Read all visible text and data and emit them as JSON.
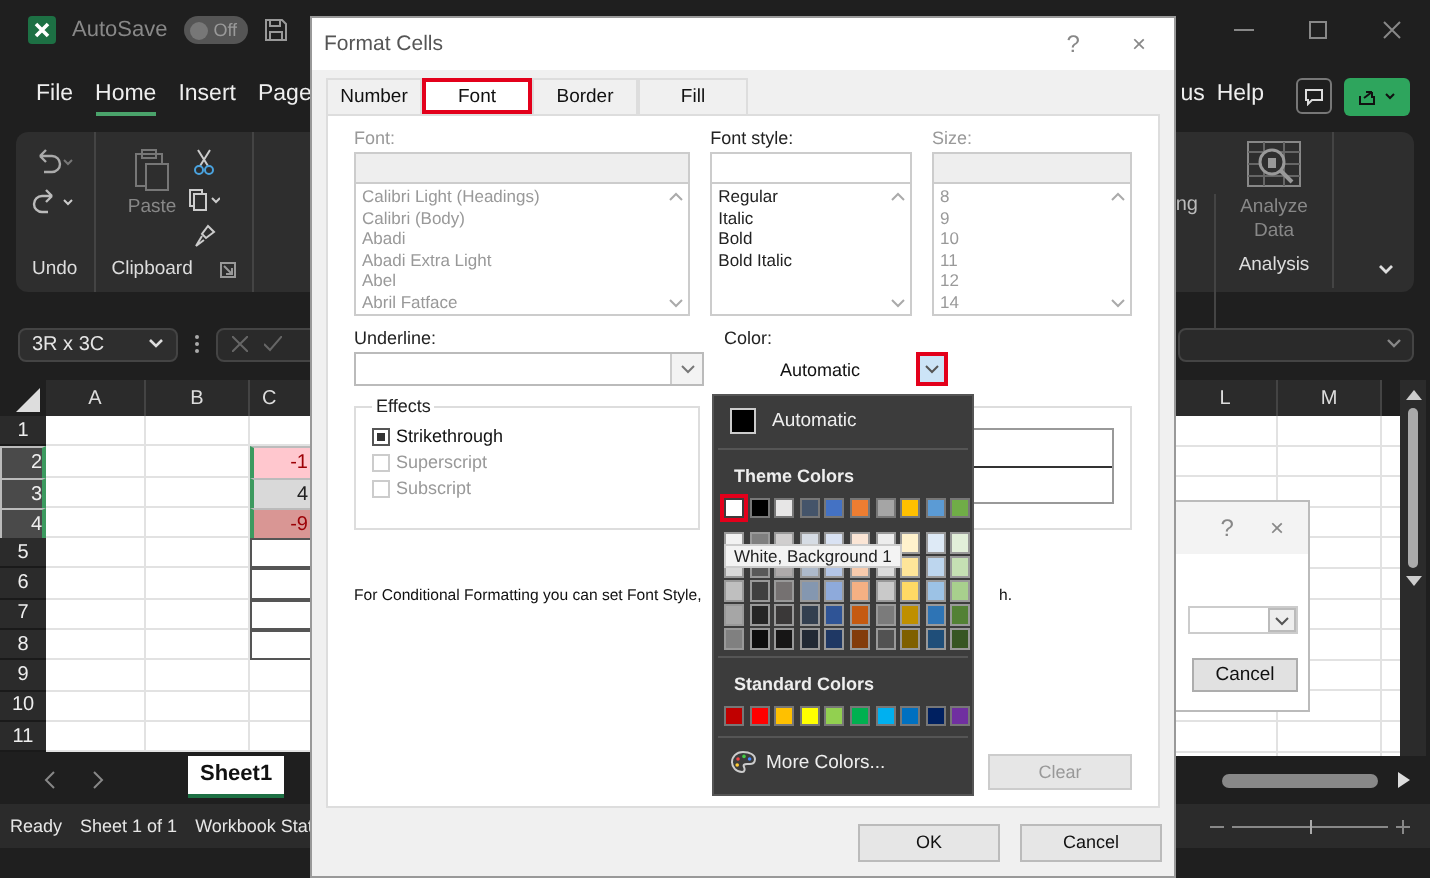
{
  "app": {
    "autosave_label": "AutoSave",
    "autosave_state": "Off",
    "autosave_on": false
  },
  "menu": [
    {
      "label": "File",
      "selected": false
    },
    {
      "label": "Home",
      "selected": true
    },
    {
      "label": "Insert",
      "selected": false
    },
    {
      "label": "Page",
      "selected": false
    }
  ],
  "menu_right": [
    "us",
    "Help"
  ],
  "ribbon": {
    "paste": "Paste",
    "undo_group": "Undo",
    "clipboard_group": "Clipboard",
    "partial_label": "ng",
    "analyze": "Analyze Data",
    "analysis_group": "Analysis"
  },
  "name_box": "3R x 3C",
  "grid": {
    "columns_left": [
      "A",
      "B",
      "C"
    ],
    "columns_right": [
      "L",
      "M"
    ],
    "rows": [
      {
        "num": "1",
        "selected": false,
        "bordered": false
      },
      {
        "num": "2",
        "selected": true,
        "bordered": false,
        "value": "-1",
        "color": "#ffc7ce",
        "kind": "negative"
      },
      {
        "num": "3",
        "selected": true,
        "bordered": false,
        "value": "4",
        "color": "#d9d9d9",
        "kind": "positive"
      },
      {
        "num": "4",
        "selected": true,
        "bordered": false,
        "value": "-9",
        "color": "#d99694",
        "kind": "negative"
      },
      {
        "num": "5",
        "selected": false,
        "bordered": true
      },
      {
        "num": "6",
        "selected": false,
        "bordered": true
      },
      {
        "num": "7",
        "selected": false,
        "bordered": true
      },
      {
        "num": "8",
        "selected": false,
        "bordered": true
      },
      {
        "num": "9",
        "selected": false,
        "bordered": false
      },
      {
        "num": "10",
        "selected": false,
        "bordered": false
      },
      {
        "num": "11",
        "selected": false,
        "bordered": false
      }
    ]
  },
  "sheet_tabs": [
    {
      "label": "Sheet1",
      "selected": true
    }
  ],
  "status_bar": [
    "Ready",
    "Sheet 1 of 1",
    "Workbook Stat"
  ],
  "zoom_slider": {
    "level": 0.5
  },
  "dialog": {
    "title": "Format Cells",
    "help": "?",
    "close": "×",
    "tabs": [
      {
        "label": "Number",
        "selected": false,
        "highlighted": false
      },
      {
        "label": "Font",
        "selected": true,
        "highlighted": true
      },
      {
        "label": "Border",
        "selected": false,
        "highlighted": false
      },
      {
        "label": "Fill",
        "selected": false,
        "highlighted": false
      }
    ],
    "font": {
      "label": "Font:",
      "items": [
        "Calibri Light (Headings)",
        "Calibri (Body)",
        "Abadi",
        "Abadi Extra Light",
        "Abel",
        "Abril Fatface"
      ]
    },
    "font_style": {
      "label": "Font style:",
      "items": [
        "Regular",
        "Italic",
        "Bold",
        "Bold Italic"
      ]
    },
    "size": {
      "label": "Size:",
      "items": [
        "8",
        "9",
        "10",
        "11",
        "12",
        "14"
      ]
    },
    "underline": {
      "label": "Underline:"
    },
    "color": {
      "label": "Color:",
      "value": "Automatic",
      "button_highlighted": true
    },
    "effects": {
      "title": "Effects",
      "items": [
        {
          "label": "Strikethrough",
          "checked": true,
          "disabled": false
        },
        {
          "label": "Superscript",
          "checked": false,
          "disabled": true
        },
        {
          "label": "Subscript",
          "checked": false,
          "disabled": true
        }
      ]
    },
    "note": "For Conditional Formatting you can set Font Style,",
    "note_tail": "h.",
    "clear": "Clear",
    "buttons": [
      "OK",
      "Cancel"
    ]
  },
  "color_menu": {
    "automatic": "Automatic",
    "theme_title": "Theme Colors",
    "theme": [
      {
        "color": "#ffffff",
        "highlighted": true,
        "shades": [
          {
            "color": "#f2f2f2"
          },
          {
            "color": "#d9d9d9"
          },
          {
            "color": "#bfbfbf"
          },
          {
            "color": "#a6a6a6"
          },
          {
            "color": "#808080"
          }
        ]
      },
      {
        "color": "#000000",
        "highlighted": false,
        "shades": [
          {
            "color": "#7f7f7f"
          },
          {
            "color": "#595959"
          },
          {
            "color": "#404040"
          },
          {
            "color": "#262626"
          },
          {
            "color": "#0d0d0d"
          }
        ]
      },
      {
        "color": "#e7e6e6",
        "highlighted": false,
        "shades": [
          {
            "color": "#d0cece"
          },
          {
            "color": "#aeaaaa"
          },
          {
            "color": "#757171"
          },
          {
            "color": "#3a3838"
          },
          {
            "color": "#171616"
          }
        ]
      },
      {
        "color": "#44546a",
        "highlighted": false,
        "shades": [
          {
            "color": "#d6dce4"
          },
          {
            "color": "#adb9ca"
          },
          {
            "color": "#8497b0"
          },
          {
            "color": "#333f4f"
          },
          {
            "color": "#222a35"
          }
        ]
      },
      {
        "color": "#4472c4",
        "highlighted": false,
        "shades": [
          {
            "color": "#d9e2f3"
          },
          {
            "color": "#b4c6e7"
          },
          {
            "color": "#8eaadb"
          },
          {
            "color": "#2f5496"
          },
          {
            "color": "#1f3864"
          }
        ]
      },
      {
        "color": "#ed7d31",
        "highlighted": false,
        "shades": [
          {
            "color": "#fbe5d5"
          },
          {
            "color": "#f7caac"
          },
          {
            "color": "#f4b083"
          },
          {
            "color": "#c55a11"
          },
          {
            "color": "#833c0b"
          }
        ]
      },
      {
        "color": "#a5a5a5",
        "highlighted": false,
        "shades": [
          {
            "color": "#ededed"
          },
          {
            "color": "#dbdbdb"
          },
          {
            "color": "#c9c9c9"
          },
          {
            "color": "#7b7b7b"
          },
          {
            "color": "#525252"
          }
        ]
      },
      {
        "color": "#ffc000",
        "highlighted": false,
        "shades": [
          {
            "color": "#fff2cc"
          },
          {
            "color": "#fee599"
          },
          {
            "color": "#ffd965"
          },
          {
            "color": "#bf8f00"
          },
          {
            "color": "#7f6000"
          }
        ]
      },
      {
        "color": "#5b9bd5",
        "highlighted": false,
        "shades": [
          {
            "color": "#deeaf6"
          },
          {
            "color": "#bdd6ee"
          },
          {
            "color": "#9cc2e5"
          },
          {
            "color": "#2e74b5"
          },
          {
            "color": "#1f4e79"
          }
        ]
      },
      {
        "color": "#70ad47",
        "highlighted": false,
        "shades": [
          {
            "color": "#e2efd9"
          },
          {
            "color": "#c5e0b3"
          },
          {
            "color": "#a8d08d"
          },
          {
            "color": "#538135"
          },
          {
            "color": "#375623"
          }
        ]
      }
    ],
    "tooltip": "White, Background 1",
    "standard_title": "Standard Colors",
    "standard": [
      {
        "color": "#c00000"
      },
      {
        "color": "#ff0000"
      },
      {
        "color": "#ffc000"
      },
      {
        "color": "#ffff00"
      },
      {
        "color": "#92d050"
      },
      {
        "color": "#00b050"
      },
      {
        "color": "#00b0f0"
      },
      {
        "color": "#0070c0"
      },
      {
        "color": "#002060"
      },
      {
        "color": "#7030a0"
      }
    ],
    "more": "More Colors..."
  },
  "second_dialog": {
    "help": "?",
    "close": "×",
    "button": "Cancel"
  }
}
